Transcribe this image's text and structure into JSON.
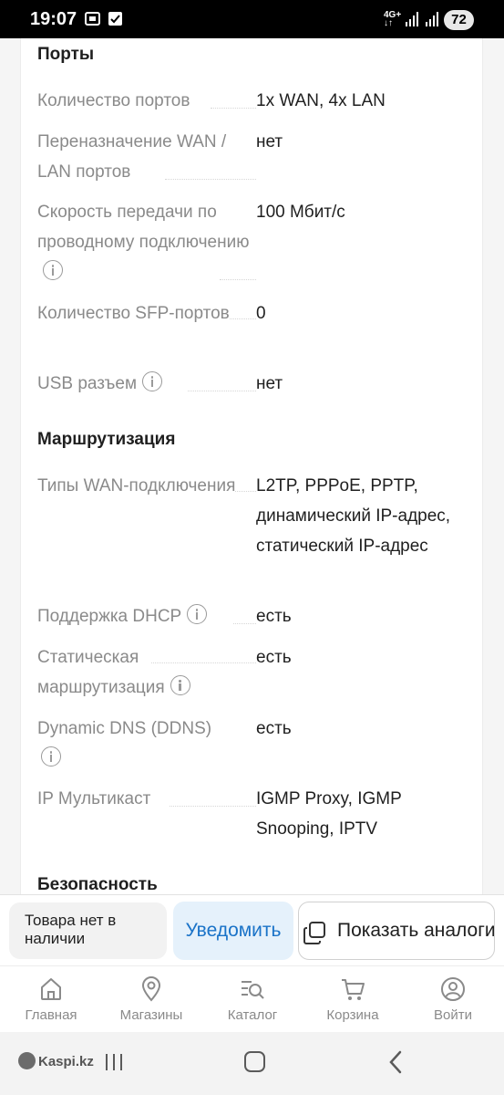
{
  "status_bar": {
    "time": "19:07",
    "network": "4G+",
    "battery": "72"
  },
  "sections": {
    "ports": {
      "title": "Порты",
      "rows": [
        {
          "label": "Количество портов",
          "value": "1x WAN, 4x LAN"
        },
        {
          "label": "Переназначение WAN / LAN портов",
          "value": "нет"
        },
        {
          "label": "Скорость передачи по проводному подключению",
          "value": "100 Мбит/с"
        },
        {
          "label": "Количество SFP-портов",
          "value": "0"
        },
        {
          "label": "USB разъем",
          "value": "нет"
        }
      ]
    },
    "routing": {
      "title": "Маршрутизация",
      "rows": [
        {
          "label": "Типы WAN-подключения",
          "value": "L2TP, PPPoE, PPTP, динамический IP-адрес, статический IP-адрес"
        },
        {
          "label": "Поддержка DHCP",
          "value": "есть"
        },
        {
          "label": "Статическая маршрутизация",
          "value": "есть"
        },
        {
          "label": "Dynamic DNS (DDNS)",
          "value": "есть"
        },
        {
          "label": "IP Мультикаст",
          "value": "IGMP Proxy, IGMP Snooping, IPTV"
        }
      ]
    },
    "security": {
      "title": "Безопасность"
    }
  },
  "action_bar": {
    "stock_status": "Товара нет в наличии",
    "notify_label": "Уведомить",
    "analogs_label": "Показать аналоги"
  },
  "tabs": [
    {
      "label": "Главная",
      "icon": "home-icon"
    },
    {
      "label": "Магазины",
      "icon": "map-pin-icon"
    },
    {
      "label": "Каталог",
      "icon": "catalog-search-icon"
    },
    {
      "label": "Корзина",
      "icon": "cart-icon"
    },
    {
      "label": "Войти",
      "icon": "user-icon"
    }
  ],
  "system_nav": {
    "brand": "Kaspi.kz"
  },
  "colors": {
    "accent": "#1a73c8",
    "notify_bg": "#e5f1fb",
    "label_gray": "#8a8a8a"
  }
}
